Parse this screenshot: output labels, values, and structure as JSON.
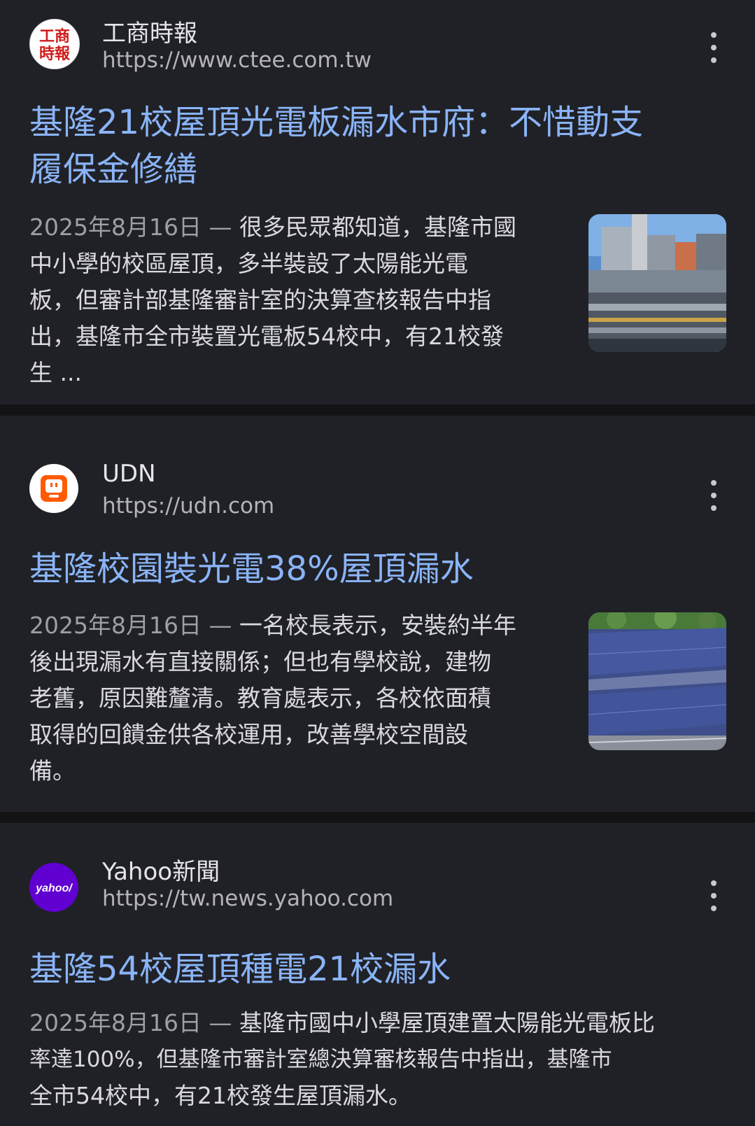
{
  "results": [
    {
      "source": "工商時報",
      "url": "https://www.ctee.com.tw",
      "logo_text_top": "工商",
      "logo_text_bottom": "時報",
      "title_line1": "基隆21校屋頂光電板漏水市府：不惜動支",
      "title_line2": "履保金修繕",
      "date": "2025年8月16日",
      "dash": "—",
      "snippet_lines": [
        "很多民眾都知道，基隆市國",
        "中小學的校區屋頂，多半裝設了太陽能光電",
        "板，但審計部基隆審計室的決算查核報告中指",
        "出，基隆市全市裝置光電板54校中，有21校發",
        "生 ..."
      ],
      "thumb_icon": "city-rooftops-photo"
    },
    {
      "source": "UDN",
      "url": "https://udn.com",
      "title_line1": "基隆校園裝光電38%屋頂漏水",
      "date": "2025年8月16日",
      "dash": "—",
      "snippet_lines": [
        "一名校長表示，安裝約半年",
        "後出現漏水有直接關係；但也有學校說，建物",
        "老舊，原因難釐清。教育處表示，各校依面積",
        "取得的回饋金供各校運用，改善學校空間設",
        "備。"
      ],
      "thumb_icon": "solar-panels-photo"
    },
    {
      "source": "Yahoo新聞",
      "url": "https://tw.news.yahoo.com",
      "logo_text": "yahoo/",
      "title_line1": "基隆54校屋頂種電21校漏水",
      "date": "2025年8月16日",
      "dash": "—",
      "snippet_lines": [
        "基隆市國中小學屋頂建置太陽能光電板比",
        "率達100%，但基隆市審計室總決算審核報告中指出，基隆市",
        "全市54校中，有21校發生屋頂漏水。"
      ]
    }
  ],
  "colors": {
    "background": "#202126",
    "separator": "#131316",
    "title_link": "#8ab4f8",
    "yahoo_purple": "#6001d2",
    "udn_orange": "#ff5a00"
  }
}
